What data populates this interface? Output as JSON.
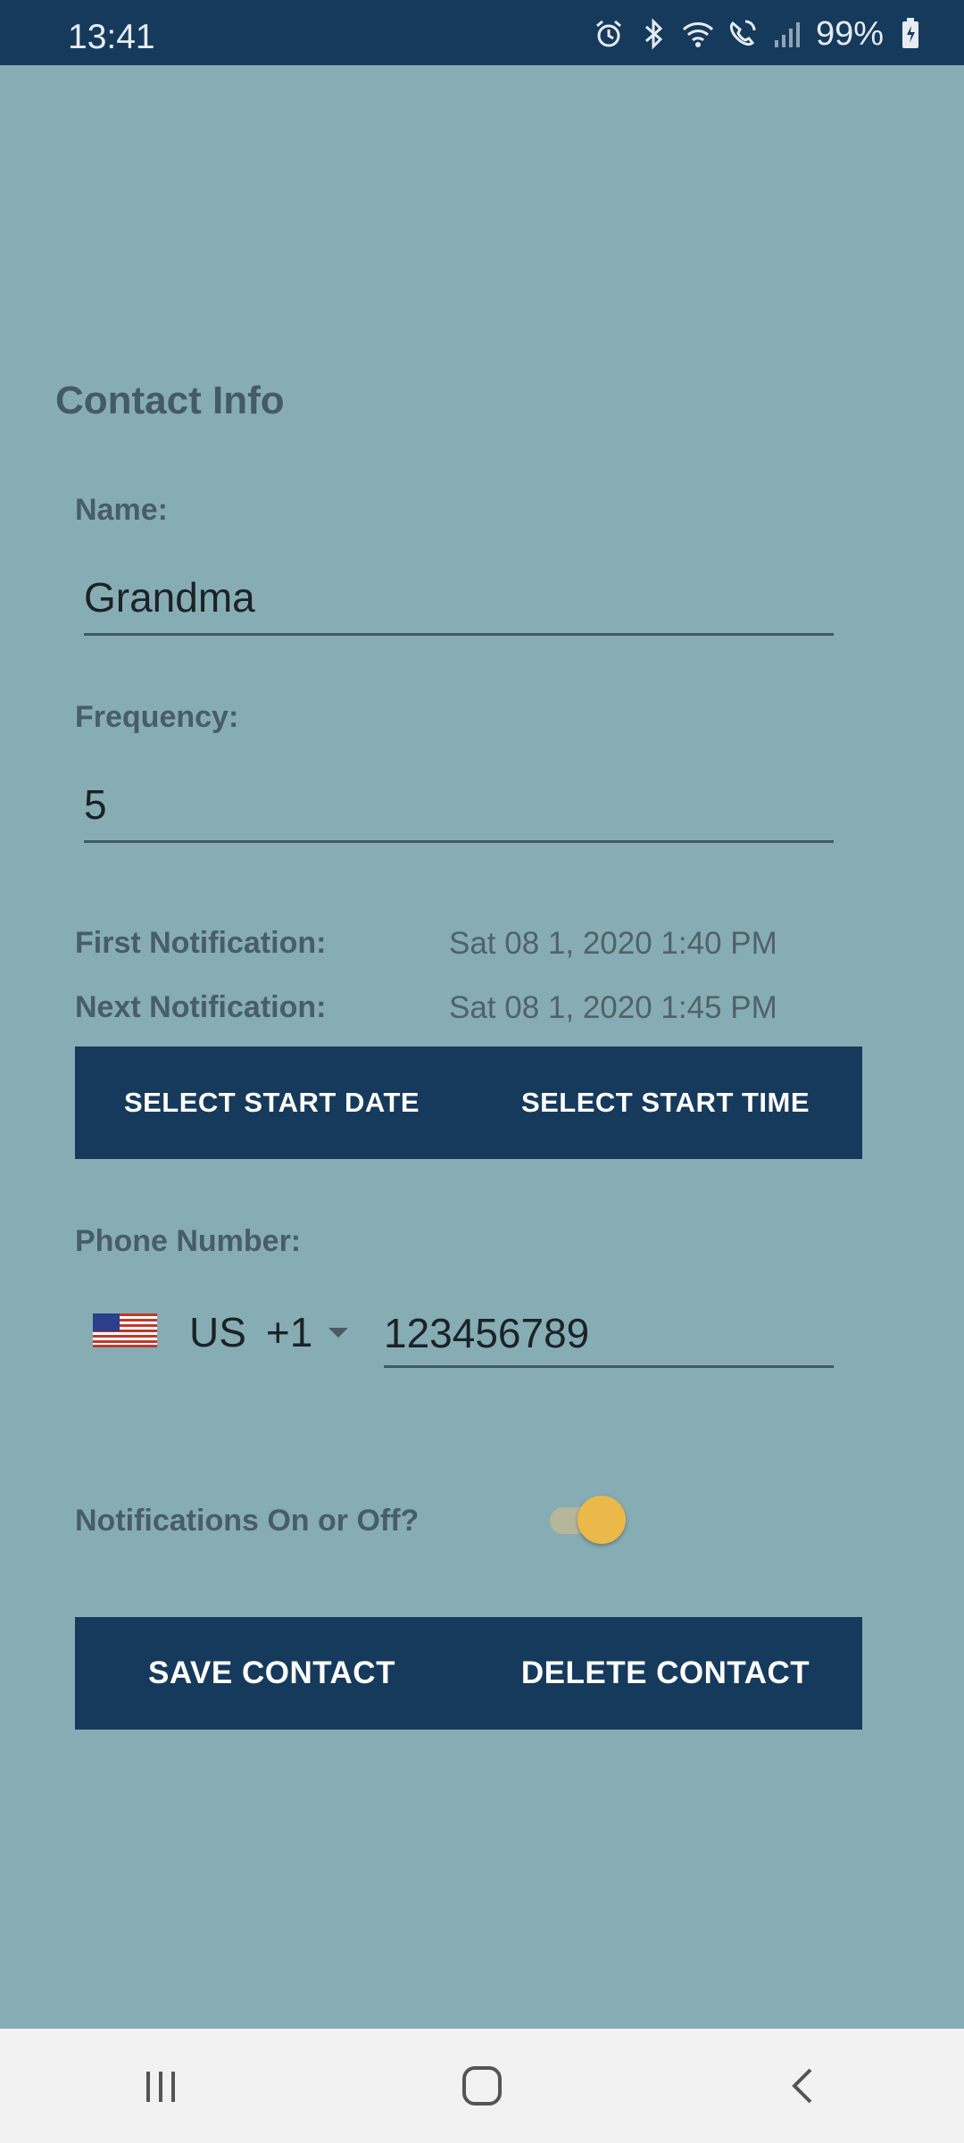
{
  "status_bar": {
    "time": "13:41",
    "battery": "99%",
    "icons": [
      "alarm-icon",
      "bluetooth-icon",
      "wifi-icon",
      "wifi-calling-icon",
      "signal-icon",
      "battery-charging-icon"
    ]
  },
  "contact": {
    "title": "Contact Info",
    "name_label": "Name:",
    "name_value": "Grandma",
    "frequency_label": "Frequency:",
    "frequency_value": "5",
    "first_notification_label": "First Notification:",
    "first_notification_value": "Sat 08 1, 2020 1:40 PM",
    "next_notification_label": "Next Notification:",
    "next_notification_value": "Sat 08 1, 2020 1:45 PM",
    "select_start_date": "SELECT START DATE",
    "select_start_time": "SELECT START TIME",
    "phone_label": "Phone Number:",
    "country_code": "US",
    "dial_code": "+1",
    "phone_value": "123456789",
    "notifications_label": "Notifications On or Off?",
    "notifications_on": true,
    "save_button": "SAVE CONTACT",
    "delete_button": "DELETE CONTACT"
  },
  "nav_bar": {
    "icons": [
      "recent-apps-icon",
      "home-icon",
      "back-icon"
    ]
  },
  "colors": {
    "background": "#86adb3",
    "primary": "#163a5c",
    "accent": "#eab94a"
  }
}
